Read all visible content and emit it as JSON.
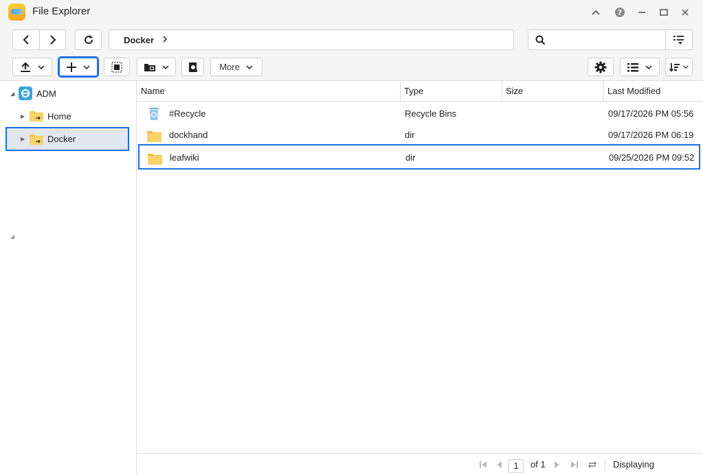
{
  "window": {
    "title": "File Explorer"
  },
  "nav": {
    "breadcrumb": [
      "Docker"
    ],
    "search_placeholder": ""
  },
  "toolbar": {
    "more_label": "More"
  },
  "tree": {
    "root": "ADM",
    "items": [
      {
        "label": "Home",
        "selected": false
      },
      {
        "label": "Docker",
        "selected": true
      }
    ]
  },
  "table": {
    "columns": [
      "Name",
      "Type",
      "Size",
      "Last Modified"
    ],
    "rows": [
      {
        "name": "#Recycle",
        "icon": "recycle-bin-icon",
        "type": "Recycle Bins",
        "size": "",
        "modified": "09/17/2026 PM 05:56",
        "selected": false
      },
      {
        "name": "dockhand",
        "icon": "folder-icon",
        "type": "dir",
        "size": "",
        "modified": "09/17/2026 PM 06:19",
        "selected": false
      },
      {
        "name": "leafwiki",
        "icon": "folder-icon",
        "type": "dir",
        "size": "",
        "modified": "09/25/2026 PM 09:52",
        "selected": true
      }
    ]
  },
  "pagination": {
    "page": "1",
    "of_label": "of 1",
    "status": "Displaying"
  },
  "colors": {
    "accent": "#1a6fe0",
    "folder": "#f7c548",
    "panel_bg": "#f5f5f5"
  }
}
